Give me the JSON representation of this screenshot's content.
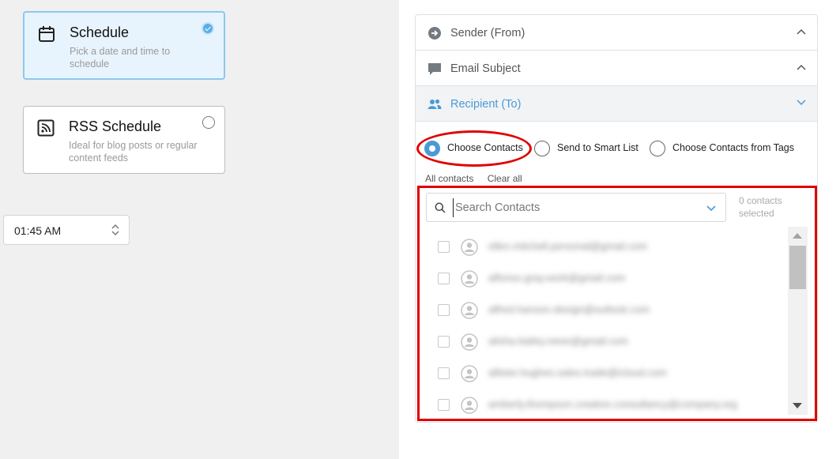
{
  "schedule_cards": [
    {
      "title": "Schedule",
      "description": "Pick a date and time to schedule",
      "selected": true,
      "icon": "calendar-icon"
    },
    {
      "title": "RSS Schedule",
      "description": "Ideal for blog posts or regular content feeds",
      "selected": false,
      "icon": "rss-icon"
    }
  ],
  "time_picker": {
    "value": "01:45 AM"
  },
  "accordion": {
    "sender_label": "Sender (From)",
    "subject_label": "Email Subject",
    "recipient_label": "Recipient (To)"
  },
  "recipient_options": {
    "choose_contacts": "Choose Contacts",
    "smart_list": "Send to Smart List",
    "from_tags": "Choose Contacts from Tags",
    "selected": "choose_contacts"
  },
  "links": {
    "all_contacts": "All contacts",
    "clear_all": "Clear all"
  },
  "search": {
    "placeholder": "Search Contacts",
    "value": ""
  },
  "selection_count": "0 contacts selected",
  "contacts": [
    "ellen.mitchell.personal@gmail.com",
    "alfonso.gray.work@gmail.com",
    "alfred.hanson.design@outlook.com",
    "alisha.bailey.news@gmail.com",
    "allister.hughes.sales.trade@icloud.com",
    "amberly.thompson.creative.consultancy@company.org"
  ],
  "colors": {
    "accent": "#4a9ad6",
    "annotation": "#e00000"
  }
}
